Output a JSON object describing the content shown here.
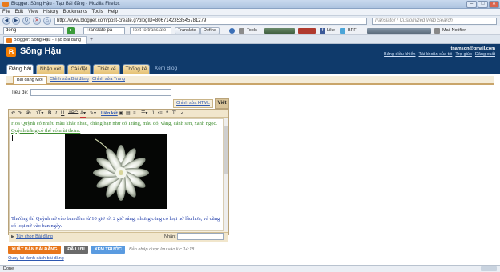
{
  "window": {
    "title": "Blogger: Sông Hậu - Tạo Bài đăng - Mozilla Firefox",
    "menu": [
      "File",
      "Edit",
      "View",
      "History",
      "Bookmarks",
      "Tools",
      "Help"
    ]
  },
  "nav": {
    "url": "http://www.blogger.com/post-create.g?blogID=8067142353545781279",
    "search_placeholder": "Translator / Customized Web Search"
  },
  "toolbar": {
    "search_value": "dòng",
    "translate_pair": "Translate pa",
    "text_to_translate": "Text to translate",
    "translate_label": "Translate",
    "define_label": "Define",
    "tools_label": "Tools",
    "like_label": "Like",
    "bpf_label": "BPF",
    "mail_label": "Mail Notifier"
  },
  "tab": {
    "label": "Blogger: Sông Hậu - Tạo Bài đăng"
  },
  "blogger": {
    "blog_name": "Sông Hậu",
    "user_email": "tnamson@gmail.com",
    "user_links": [
      "Bảng điều khiển",
      "Tài khoản của tôi",
      "Trợ giúp",
      "Đăng xuất"
    ],
    "main_tabs": [
      {
        "label": "Đăng bài",
        "active": true
      },
      {
        "label": "Nhận xét",
        "active": false
      },
      {
        "label": "Cài đặt",
        "active": false
      },
      {
        "label": "Thiết kế",
        "active": false
      },
      {
        "label": "Thống kê",
        "active": false
      },
      {
        "label": "Xem Blog",
        "active": false
      }
    ],
    "sub_tabs": [
      {
        "label": "Bài đăng Mới",
        "active": true
      },
      {
        "label": "Chỉnh sửa Bài đăng",
        "active": false
      },
      {
        "label": "Chỉnh sửa Trang",
        "active": false
      }
    ]
  },
  "editor": {
    "title_label": "Tiêu đề:",
    "title_value": "",
    "mode_html": "Chỉnh sửa HTML",
    "mode_compose": "Viết",
    "link_label": "Liên kết",
    "paragraph_1": "Hoa Quỳnh có nhiều màu khác nhau, chẳng hạn như có Trắng, màu đỏ, vàng, cánh sen, xanh ngọc. Quỳnh trắng có thể có mùi thơm.",
    "paragraph_2": "Thường thì Quỳnh nở vào ban đêm từ 10 giờ tới 2 giờ sáng, nhưng cũng có loại nở lâu hơn, và cũng có loại nở vào ban ngày.",
    "post_options": "Tùy chọn Bài đăng",
    "labels_label": "Nhãn:",
    "labels_value": ""
  },
  "actions": {
    "publish": "XUẤT BẢN BÀI ĐĂNG",
    "saved": "ĐÃ LƯU",
    "preview": "XEM TRƯỚC",
    "autosave_note": "Bản nháp được lưu vào lúc 14:18",
    "back_link": "Quay lại danh sách bài đăng"
  },
  "status": {
    "text": "Done"
  },
  "colors": {
    "blogger_header": "#0f3a6b",
    "publish_button": "#e8761a",
    "saved_button": "#6b6b6b",
    "preview_button": "#5a9be0",
    "link_blue": "#2d57b0"
  }
}
